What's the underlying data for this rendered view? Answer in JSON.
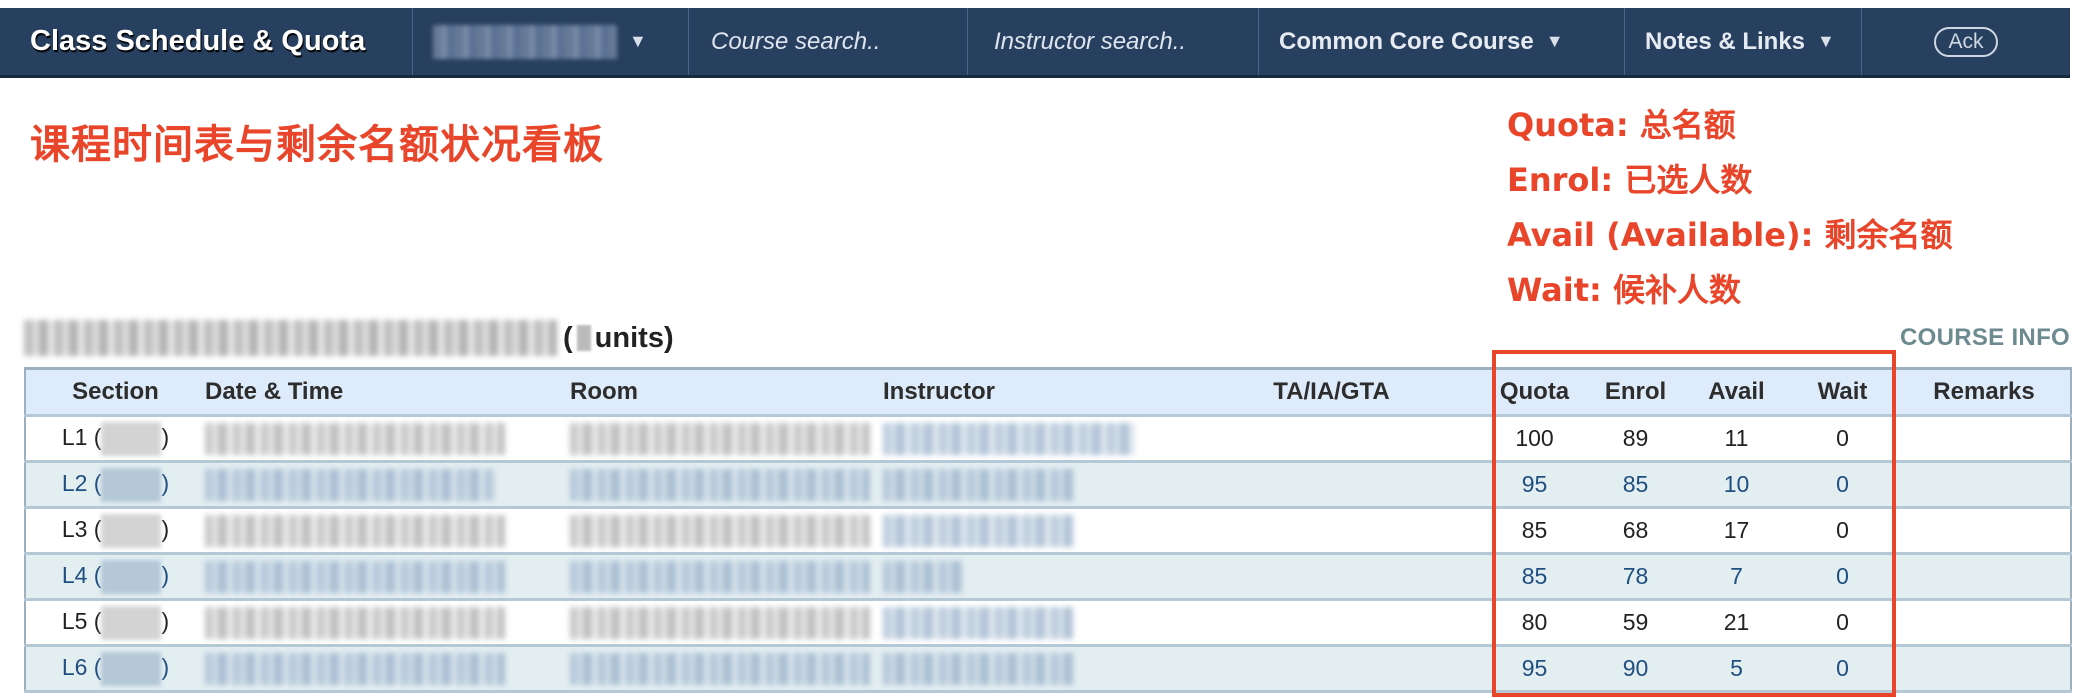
{
  "nav": {
    "title": "Class Schedule & Quota",
    "term_selector": {
      "value": "",
      "caret": "▼"
    },
    "course_search": {
      "placeholder": "Course search.."
    },
    "instructor_search": {
      "placeholder": "Instructor search.."
    },
    "menu_common_core": {
      "label": "Common Core Course",
      "caret": "▼"
    },
    "menu_notes_links": {
      "label": "Notes & Links",
      "caret": "▼"
    },
    "ack_button": {
      "label": "Ack"
    }
  },
  "annotation": {
    "heading": "课程时间表与剩余名额状况看板",
    "legend": [
      "Quota: 总名额",
      "Enrol: 已选人数",
      "Avail (Available): 剩余名额",
      "Wait: 候补人数"
    ],
    "highlight_color": "#e8452a"
  },
  "course": {
    "units_label": "units)",
    "open_paren": "(",
    "course_info_link": "COURSE INFO"
  },
  "table": {
    "headers": [
      "Section",
      "Date & Time",
      "Room",
      "Instructor",
      "TA/IA/GTA",
      "Quota",
      "Enrol",
      "Avail",
      "Wait",
      "Remarks"
    ],
    "rows": [
      {
        "section": "L1",
        "quota": "100",
        "enrol": "89",
        "avail": "11",
        "wait": "0",
        "ta": "",
        "remarks": ""
      },
      {
        "section": "L2",
        "quota": "95",
        "enrol": "85",
        "avail": "10",
        "wait": "0",
        "ta": "",
        "remarks": ""
      },
      {
        "section": "L3",
        "quota": "85",
        "enrol": "68",
        "avail": "17",
        "wait": "0",
        "ta": "",
        "remarks": ""
      },
      {
        "section": "L4",
        "quota": "85",
        "enrol": "78",
        "avail": "7",
        "wait": "0",
        "ta": "",
        "remarks": ""
      },
      {
        "section": "L5",
        "quota": "80",
        "enrol": "59",
        "avail": "21",
        "wait": "0",
        "ta": "",
        "remarks": ""
      },
      {
        "section": "L6",
        "quota": "95",
        "enrol": "90",
        "avail": "5",
        "wait": "0",
        "ta": "",
        "remarks": ""
      }
    ],
    "row_colors": {
      "odd_text": "#222222",
      "even_text": "#1f4e80",
      "even_bg": "#e3eef1",
      "header_bg": "#deebfa"
    }
  },
  "colors": {
    "nav_bg": "#28405f",
    "course_info": "#6c8a90"
  }
}
